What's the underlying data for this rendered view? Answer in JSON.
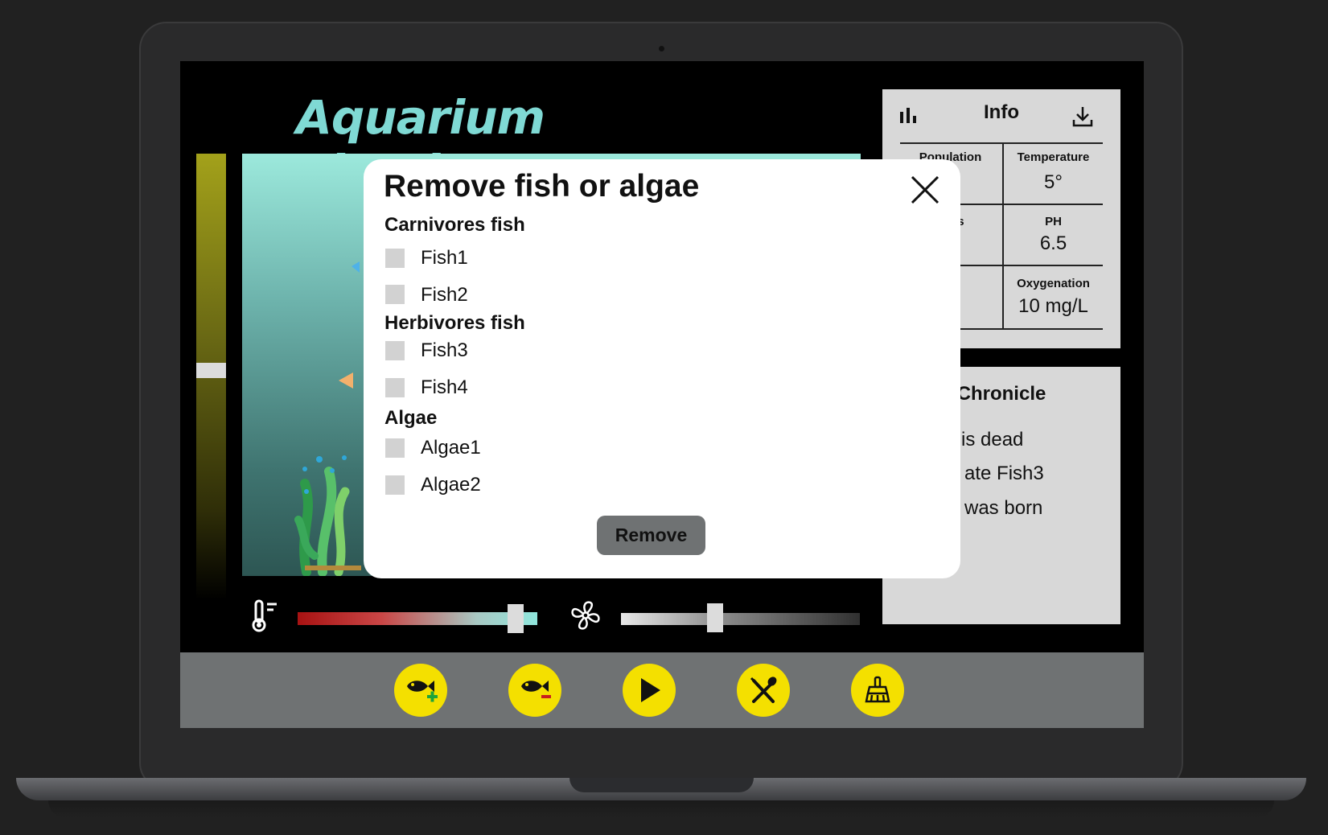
{
  "app": {
    "title": "Aquarium Simulator"
  },
  "info": {
    "title": "Info",
    "cells": [
      {
        "label": "Population",
        "value": ""
      },
      {
        "label": "Temperature",
        "value": "5°"
      },
      {
        "label": "ness",
        "value": "%"
      },
      {
        "label": "PH",
        "value": "6.5"
      },
      {
        "label": "rity",
        "value": "%"
      },
      {
        "label": "Oxygenation",
        "value": "10 mg/L"
      }
    ]
  },
  "chronicle": {
    "title": "Chronicle",
    "lines": [
      "is dead",
      "ate Fish3",
      "was born"
    ]
  },
  "controls": {
    "water_level": 0.45,
    "temperature_level": 0.87,
    "aeration_level": 0.38
  },
  "toolbar": {
    "buttons": [
      {
        "name": "add-fish",
        "icon": "fish-plus-icon"
      },
      {
        "name": "remove-fish",
        "icon": "fish-minus-icon"
      },
      {
        "name": "play",
        "icon": "play-icon"
      },
      {
        "name": "feed",
        "icon": "fork-spoon-icon"
      },
      {
        "name": "clean",
        "icon": "broom-icon"
      }
    ]
  },
  "modal": {
    "title": "Remove fish or algae",
    "groups": [
      {
        "title": "Carnivores fish",
        "items": [
          "Fish1",
          "Fish2"
        ]
      },
      {
        "title": "Herbivores fish",
        "items": [
          "Fish3",
          "Fish4"
        ]
      },
      {
        "title": "Algae",
        "items": [
          "Algae1",
          "Algae2"
        ]
      }
    ],
    "remove_label": "Remove"
  },
  "colors": {
    "accent": "#f4e000",
    "title": "#7fd9d4",
    "panel": "#d8d8d8",
    "toolbar": "#6f7273"
  }
}
